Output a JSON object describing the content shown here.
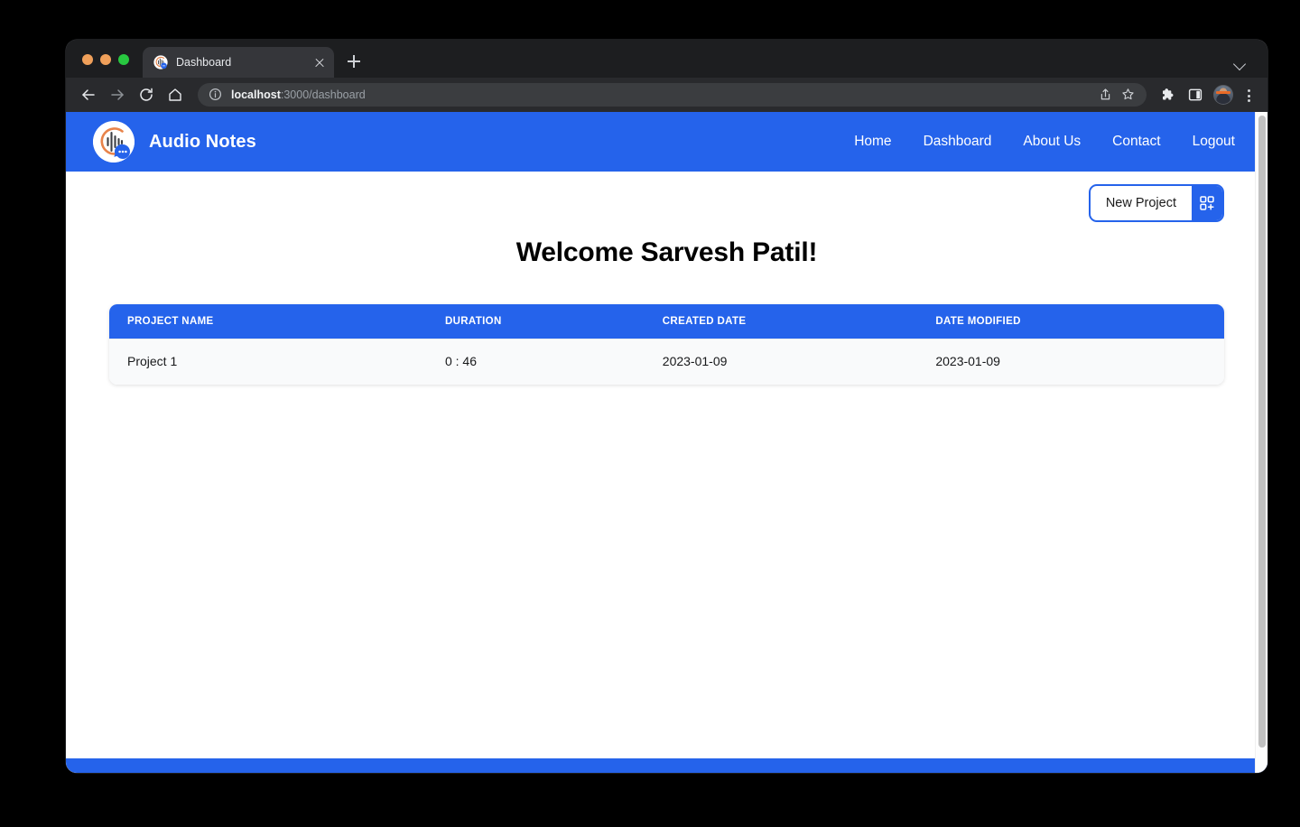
{
  "browser": {
    "tab": {
      "title": "Dashboard",
      "favicon": "audio-notes-logo",
      "close_icon": "close-icon"
    },
    "new_tab_icon": "plus-icon",
    "tab_list_chevron_icon": "chevron-down-icon",
    "traffic_lights": [
      "close-light",
      "minimize-light",
      "maximize-light"
    ],
    "nav": {
      "back_icon": "arrow-left-icon",
      "forward_icon": "arrow-right-icon",
      "reload_icon": "reload-icon",
      "home_icon": "home-icon"
    },
    "omnibox": {
      "info_icon": "info-circle-icon",
      "url_host": "localhost",
      "url_rest": ":3000/dashboard",
      "share_icon": "share-icon",
      "bookmark_icon": "star-icon"
    },
    "toolbar": {
      "extensions_icon": "puzzle-icon",
      "side_panel_icon": "side-panel-icon",
      "profile_icon": "avatar-icon",
      "menu_icon": "three-dot-menu-icon"
    }
  },
  "app": {
    "brand": {
      "logo": "audio-notes-logo",
      "title": "Audio Notes"
    },
    "nav_links": [
      {
        "label": "Home"
      },
      {
        "label": "Dashboard"
      },
      {
        "label": "About Us"
      },
      {
        "label": "Contact"
      },
      {
        "label": "Logout"
      }
    ],
    "new_project": {
      "label": "New Project",
      "icon": "grid-plus-icon"
    },
    "welcome_heading": "Welcome Sarvesh Patil!",
    "table": {
      "columns": [
        "PROJECT NAME",
        "DURATION",
        "CREATED DATE",
        "DATE MODIFIED"
      ],
      "rows": [
        {
          "project_name": "Project 1",
          "duration": "0 : 46",
          "created_date": "2023-01-09",
          "date_modified": "2023-01-09"
        }
      ]
    },
    "colors": {
      "primary_blue": "#2563eb",
      "row_background": "#f9fafb",
      "heading_text": "#000000"
    }
  }
}
